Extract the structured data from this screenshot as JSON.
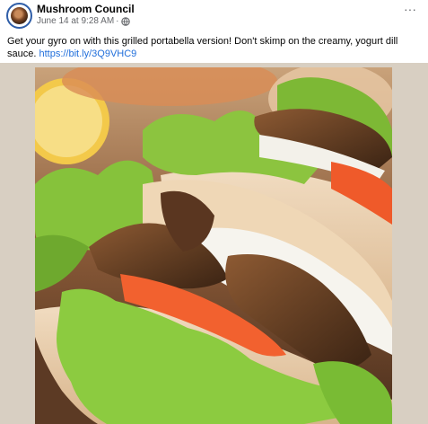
{
  "post": {
    "page_name": "Mushroom Council",
    "timestamp": "June 14 at 9:28 AM",
    "separator": "·",
    "audience_icon": "globe-icon",
    "more_icon": "more-options-icon",
    "more_label": "···",
    "caption_text": "Get your gyro on with this grilled portabella version! Don't skimp on the creamy, yogurt dill sauce. ",
    "caption_link": "https://bit.ly/3Q9VHC9"
  },
  "colors": {
    "link": "#216fdb",
    "meta": "#65676b",
    "avatar_ring": "#2f5ea8"
  }
}
